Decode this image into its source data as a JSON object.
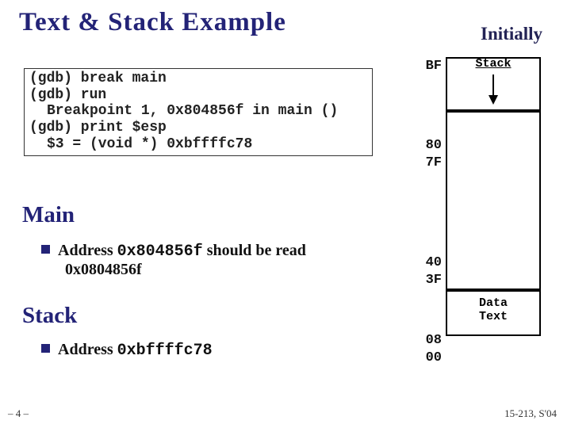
{
  "title": "Text & Stack Example",
  "initially": "Initially",
  "gdb": {
    "l1": "(gdb) break main",
    "l2": "(gdb) run",
    "l3": "Breakpoint 1, 0x804856f in main ()",
    "l4": "(gdb) print $esp",
    "l5": "$3 = (void *) 0xbffffc78"
  },
  "sections": {
    "main": "Main",
    "stack": "Stack"
  },
  "bullets": {
    "main_line1a": "Address ",
    "main_code": "0x804856f",
    "main_line1b": " should be read",
    "main_line2": "0x0804856f",
    "stack_line1a": "Address ",
    "stack_code": "0xbffffc78"
  },
  "addrs": {
    "a1": "BF",
    "a2": "80",
    "a3": "7F",
    "a4": "40",
    "a5": "3F",
    "a6": "08",
    "a7": "00"
  },
  "diagram": {
    "stack_label": "Stack",
    "data_text_label1": "Data",
    "data_text_label2": "Text"
  },
  "footer": {
    "page": "– 4 –",
    "course": "15-213, S'04"
  }
}
